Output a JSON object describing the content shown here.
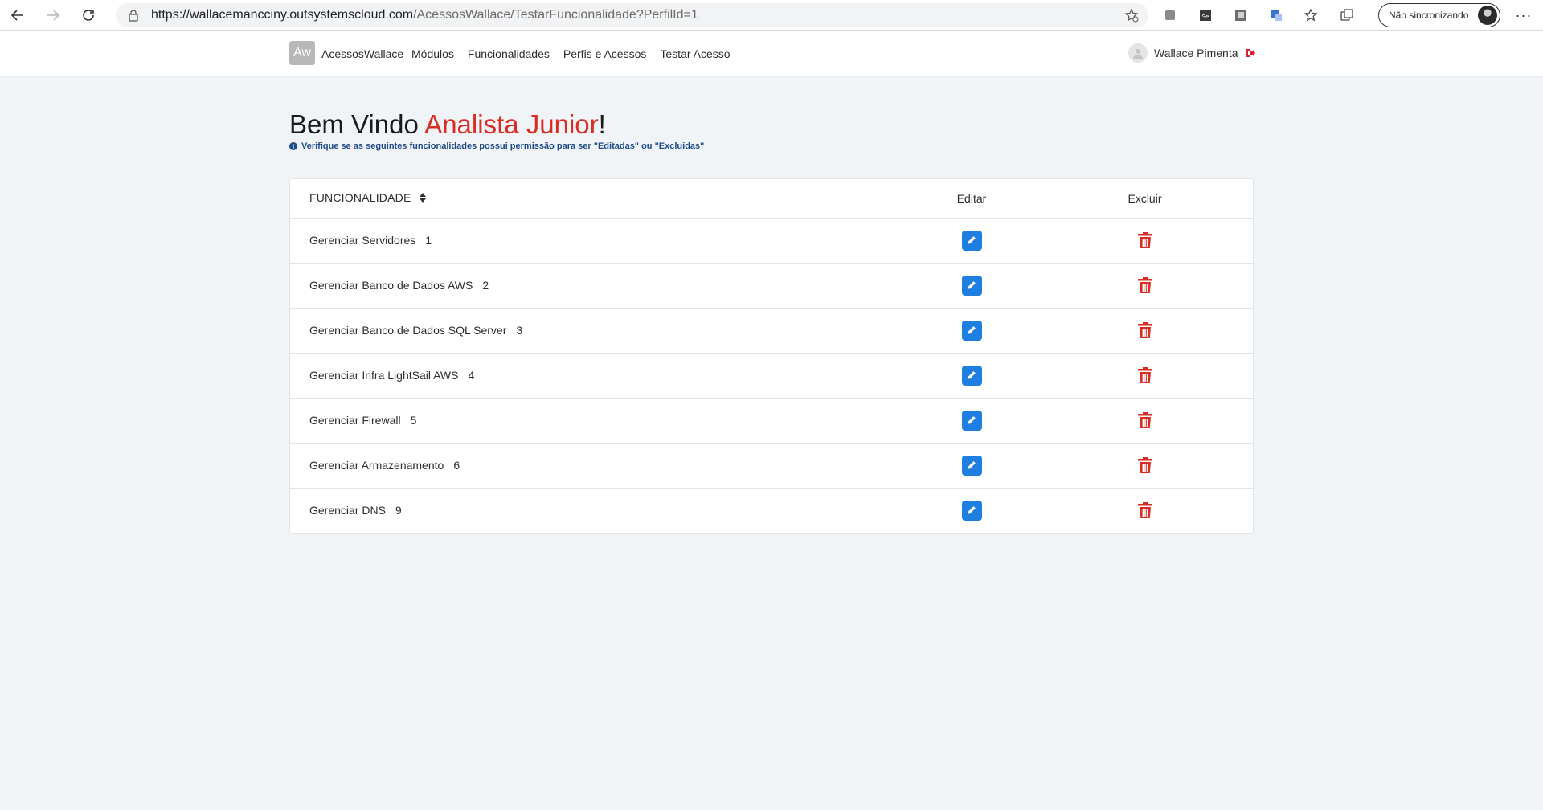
{
  "browser": {
    "url_host": "https://wallacemancciny.outsystemscloud.com",
    "url_path": "/AcessosWallace/TestarFuncionalidade?PerfilId=1",
    "sync_label": "Não sincronizando"
  },
  "header": {
    "logo_text": "Aw",
    "app_name": "AcessosWallace",
    "menu": [
      "Módulos",
      "Funcionalidades",
      "Perfis e Acessos",
      "Testar Acesso"
    ],
    "user_name": "Wallace Pimenta"
  },
  "main": {
    "welcome_prefix": "Bem Vindo ",
    "role": "Analista Junior",
    "welcome_suffix": "!",
    "info_text": "Verifique se as seguintes funcionalidades possui permissão para ser \"Editadas\" ou \"Excluidas\""
  },
  "table": {
    "headers": {
      "funcionalidade": "FUNCIONALIDADE",
      "editar": "Editar",
      "excluir": "Excluir"
    },
    "rows": [
      {
        "name": "Gerenciar Servidores",
        "id": "1"
      },
      {
        "name": "Gerenciar Banco de Dados AWS",
        "id": "2"
      },
      {
        "name": "Gerenciar Banco de Dados SQL Server",
        "id": "3"
      },
      {
        "name": "Gerenciar Infra LightSail AWS",
        "id": "4"
      },
      {
        "name": "Gerenciar Firewall",
        "id": "5"
      },
      {
        "name": "Gerenciar Armazenamento",
        "id": "6"
      },
      {
        "name": "Gerenciar DNS",
        "id": "9"
      }
    ]
  },
  "colors": {
    "accent_red": "#d92c23",
    "edit_blue": "#1f7fe0",
    "info_blue": "#1e4a8a"
  },
  "icons": {
    "edit": "pencil-icon",
    "delete": "trash-icon",
    "sort": "sort-icon",
    "logout": "logout-icon",
    "info": "info-icon"
  }
}
